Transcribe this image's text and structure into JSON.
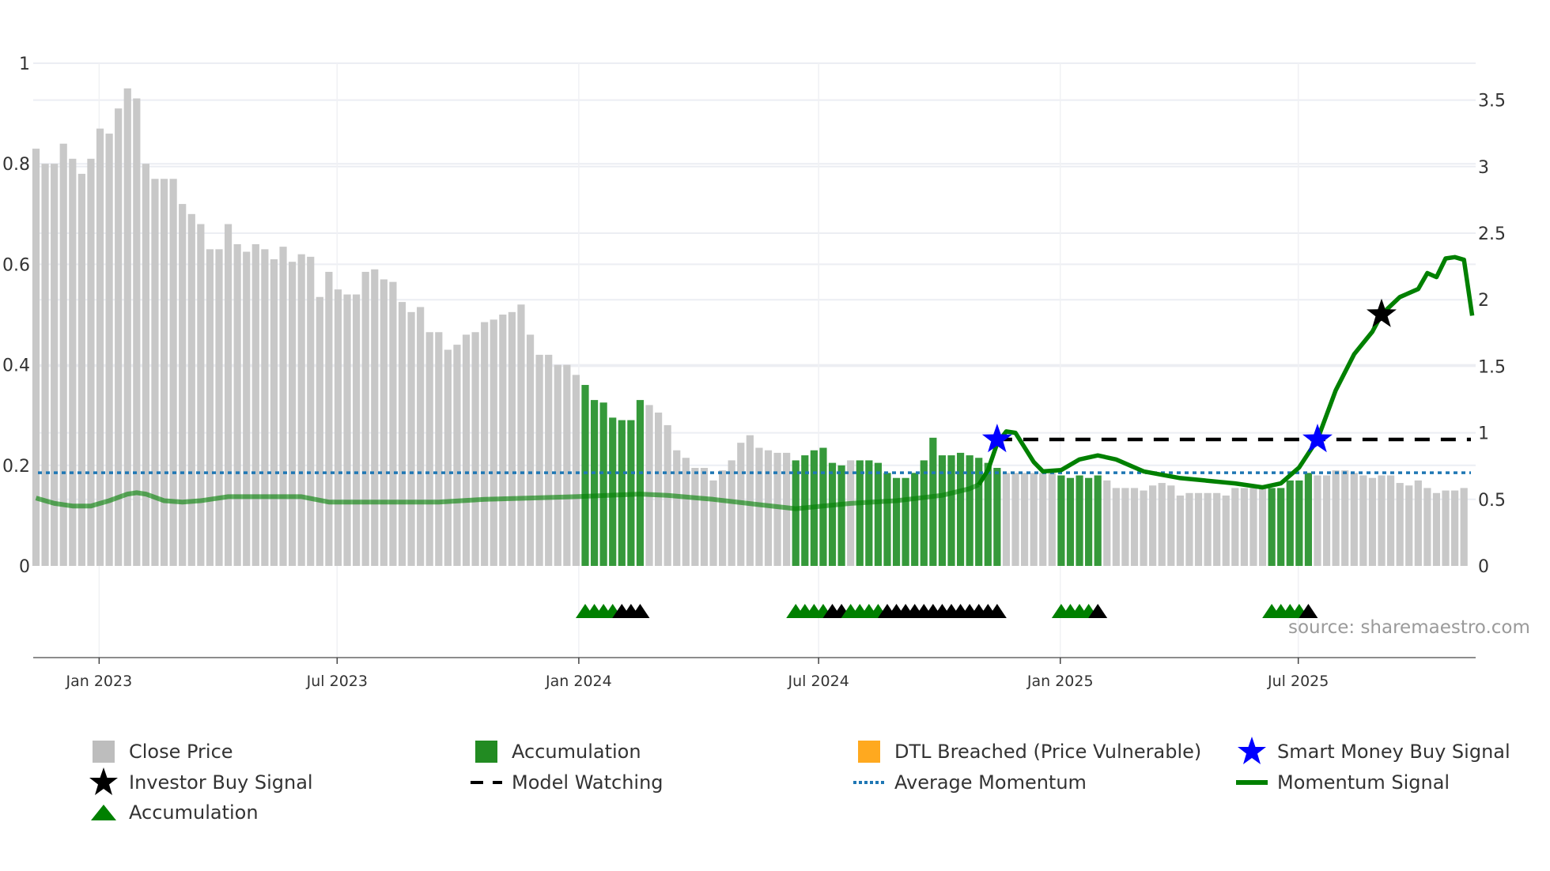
{
  "chart_data": {
    "type": "bar",
    "title": "",
    "xlabel": "",
    "ylabel_left": "",
    "ylabel_right": "",
    "left_axis": {
      "range": [
        0,
        1
      ],
      "ticks": [
        "0",
        "0.2",
        "0.4",
        "0.6",
        "0.8",
        "1"
      ],
      "tick_values": [
        0,
        0.2,
        0.4,
        0.6,
        0.8,
        1
      ]
    },
    "right_axis": {
      "range": [
        0,
        3.5
      ],
      "ticks": [
        "0",
        "0.5",
        "1",
        "1.5",
        "2",
        "2.5",
        "3",
        "3.5"
      ],
      "tick_values": [
        0,
        0.5,
        1,
        1.5,
        2,
        2.5,
        3,
        3.5
      ]
    },
    "x_axis": {
      "unit": "week index",
      "ticks": [
        {
          "label": "Jan 2023",
          "week": 7.9
        },
        {
          "label": "Jul 2023",
          "week": 33.9
        },
        {
          "label": "Jan 2024",
          "week": 60.3
        },
        {
          "label": "Jul 2024",
          "week": 86.5
        },
        {
          "label": "Jan 2025",
          "week": 112.9
        },
        {
          "label": "Jul 2025",
          "week": 138.9
        }
      ]
    },
    "grid": true,
    "close_price": [
      0.83,
      0.8,
      0.8,
      0.84,
      0.81,
      0.78,
      0.81,
      0.87,
      0.86,
      0.91,
      0.95,
      0.93,
      0.8,
      0.77,
      0.77,
      0.77,
      0.72,
      0.7,
      0.68,
      0.63,
      0.63,
      0.68,
      0.64,
      0.625,
      0.64,
      0.63,
      0.61,
      0.635,
      0.605,
      0.62,
      0.615,
      0.535,
      0.585,
      0.55,
      0.54,
      0.54,
      0.585,
      0.59,
      0.57,
      0.565,
      0.525,
      0.505,
      0.515,
      0.465,
      0.465,
      0.43,
      0.44,
      0.46,
      0.465,
      0.485,
      0.49,
      0.5,
      0.505,
      0.52,
      0.46,
      0.42,
      0.42,
      0.4,
      0.4,
      0.38,
      0.36,
      0.33,
      0.325,
      0.295,
      0.29,
      0.29,
      0.33,
      0.32,
      0.305,
      0.28,
      0.23,
      0.215,
      0.195,
      0.195,
      0.17,
      0.19,
      0.21,
      0.245,
      0.26,
      0.235,
      0.23,
      0.225,
      0.225,
      0.21,
      0.22,
      0.23,
      0.235,
      0.205,
      0.2,
      0.21,
      0.21,
      0.21,
      0.205,
      0.185,
      0.175,
      0.175,
      0.185,
      0.21,
      0.255,
      0.22,
      0.22,
      0.225,
      0.22,
      0.215,
      0.205,
      0.195,
      0.185,
      0.185,
      0.185,
      0.185,
      0.185,
      0.185,
      0.18,
      0.175,
      0.18,
      0.175,
      0.18,
      0.17,
      0.155,
      0.155,
      0.155,
      0.15,
      0.16,
      0.165,
      0.16,
      0.14,
      0.145,
      0.145,
      0.145,
      0.145,
      0.14,
      0.155,
      0.155,
      0.155,
      0.155,
      0.155,
      0.155,
      0.17,
      0.17,
      0.185,
      0.18,
      0.18,
      0.19,
      0.19,
      0.185,
      0.18,
      0.175,
      0.18,
      0.18,
      0.165,
      0.16,
      0.17,
      0.155,
      0.145,
      0.15,
      0.15,
      0.155
    ],
    "accumulation_ranges": [
      [
        61,
        67
      ],
      [
        84,
        89
      ],
      [
        91,
        106
      ],
      [
        113,
        117
      ],
      [
        136,
        140
      ]
    ],
    "momentum_signal": {
      "axis": "right",
      "points": [
        [
          1,
          0.51
        ],
        [
          3,
          0.47
        ],
        [
          5,
          0.45
        ],
        [
          7,
          0.45
        ],
        [
          9,
          0.49
        ],
        [
          11,
          0.54
        ],
        [
          12,
          0.55
        ],
        [
          13,
          0.54
        ],
        [
          15,
          0.49
        ],
        [
          17,
          0.48
        ],
        [
          19,
          0.49
        ],
        [
          22,
          0.52
        ],
        [
          30,
          0.52
        ],
        [
          33,
          0.48
        ],
        [
          45,
          0.48
        ],
        [
          50,
          0.5
        ],
        [
          55,
          0.51
        ],
        [
          60,
          0.52
        ],
        [
          67,
          0.54
        ],
        [
          70,
          0.53
        ],
        [
          75,
          0.5
        ],
        [
          80,
          0.46
        ],
        [
          84,
          0.43
        ],
        [
          90,
          0.47
        ],
        [
          95,
          0.49
        ],
        [
          100,
          0.53
        ],
        [
          103,
          0.58
        ],
        [
          104,
          0.61
        ],
        [
          105,
          0.72
        ],
        [
          106,
          0.92
        ],
        [
          107,
          1.01
        ],
        [
          108,
          1.0
        ],
        [
          110,
          0.78
        ],
        [
          111,
          0.71
        ],
        [
          113,
          0.72
        ],
        [
          115,
          0.8
        ],
        [
          117,
          0.83
        ],
        [
          119,
          0.8
        ],
        [
          122,
          0.71
        ],
        [
          126,
          0.66
        ],
        [
          132,
          0.62
        ],
        [
          135,
          0.59
        ],
        [
          137,
          0.62
        ],
        [
          139,
          0.74
        ],
        [
          141,
          0.95
        ],
        [
          143,
          1.32
        ],
        [
          145,
          1.59
        ],
        [
          147,
          1.76
        ],
        [
          148,
          1.89
        ],
        [
          150,
          2.02
        ],
        [
          152,
          2.08
        ],
        [
          153,
          2.2
        ],
        [
          154,
          2.17
        ],
        [
          155,
          2.31
        ],
        [
          156,
          2.32
        ],
        [
          157,
          2.3
        ],
        [
          157.9,
          1.88
        ]
      ]
    },
    "average_momentum": {
      "axis": "right",
      "value": 0.7
    },
    "model_watching": {
      "axis": "right",
      "value": 0.95,
      "from_week": 106
    },
    "smart_money_buy_signals": [
      {
        "week": 106,
        "value": 0.95
      },
      {
        "week": 141,
        "value": 0.95
      }
    ],
    "investor_buy_signals": [
      {
        "week": 148,
        "value": 1.89
      }
    ],
    "accumulation_markers": [
      {
        "week": 61,
        "type": "green"
      },
      {
        "week": 62,
        "type": "green"
      },
      {
        "week": 63,
        "type": "green"
      },
      {
        "week": 64,
        "type": "green"
      },
      {
        "week": 65,
        "type": "black"
      },
      {
        "week": 66,
        "type": "black"
      },
      {
        "week": 67,
        "type": "black"
      },
      {
        "week": 84,
        "type": "green"
      },
      {
        "week": 85,
        "type": "green"
      },
      {
        "week": 86,
        "type": "green"
      },
      {
        "week": 87,
        "type": "green"
      },
      {
        "week": 88,
        "type": "black"
      },
      {
        "week": 89,
        "type": "black"
      },
      {
        "week": 90,
        "type": "green"
      },
      {
        "week": 91,
        "type": "green"
      },
      {
        "week": 92,
        "type": "green"
      },
      {
        "week": 93,
        "type": "green"
      },
      {
        "week": 94,
        "type": "black"
      },
      {
        "week": 95,
        "type": "black"
      },
      {
        "week": 96,
        "type": "black"
      },
      {
        "week": 97,
        "type": "black"
      },
      {
        "week": 98,
        "type": "black"
      },
      {
        "week": 99,
        "type": "black"
      },
      {
        "week": 100,
        "type": "black"
      },
      {
        "week": 101,
        "type": "black"
      },
      {
        "week": 102,
        "type": "black"
      },
      {
        "week": 103,
        "type": "black"
      },
      {
        "week": 104,
        "type": "black"
      },
      {
        "week": 105,
        "type": "black"
      },
      {
        "week": 106,
        "type": "black"
      },
      {
        "week": 113,
        "type": "green"
      },
      {
        "week": 114,
        "type": "green"
      },
      {
        "week": 115,
        "type": "green"
      },
      {
        "week": 116,
        "type": "green"
      },
      {
        "week": 117,
        "type": "black"
      },
      {
        "week": 136,
        "type": "green"
      },
      {
        "week": 137,
        "type": "green"
      },
      {
        "week": 138,
        "type": "green"
      },
      {
        "week": 139,
        "type": "green"
      },
      {
        "week": 140,
        "type": "black"
      }
    ],
    "source_note": "source: sharemaestro.com",
    "legend_placement": "bottom",
    "legend": [
      {
        "label": "Close Price",
        "icon": "square",
        "color": "#bdbdbd"
      },
      {
        "label": "Accumulation",
        "icon": "square",
        "color": "#228b22"
      },
      {
        "label": "DTL Breached (Price Vulnerable)",
        "icon": "square",
        "color": "#ffa91f"
      },
      {
        "label": "Smart Money Buy Signal",
        "icon": "star",
        "color": "#0000ff"
      },
      {
        "label": "Investor Buy Signal",
        "icon": "star",
        "color": "#000000"
      },
      {
        "label": "Model Watching",
        "icon": "dash",
        "color": "#000000"
      },
      {
        "label": "Average Momentum",
        "icon": "dot",
        "color": "#1f77b4"
      },
      {
        "label": "Momentum Signal",
        "icon": "line",
        "color": "#008000"
      },
      {
        "label": "Accumulation",
        "icon": "triangle",
        "color": "#008000"
      }
    ],
    "colors": {
      "price": "#c8c8c8",
      "accumulation_bar": "#35993a",
      "momentum": "#008000",
      "average": "#1f77b4",
      "grid": "#eceef3",
      "axis": "#8c8c8c"
    }
  }
}
